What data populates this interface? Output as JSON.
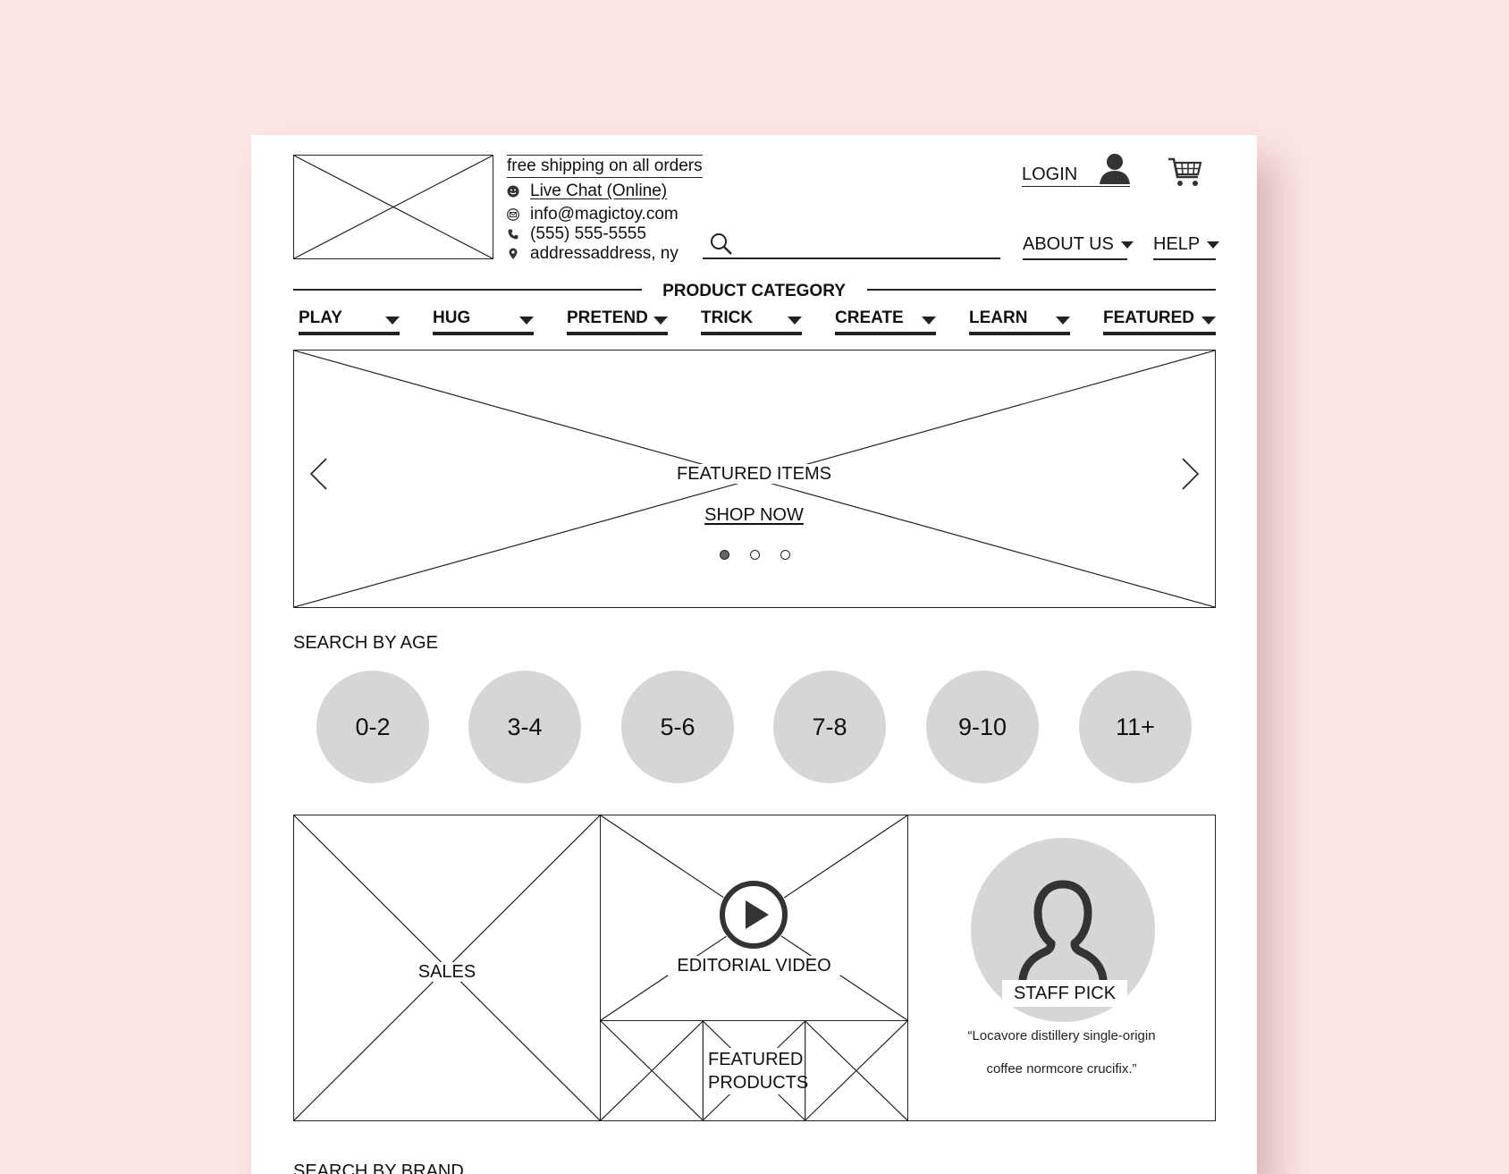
{
  "header": {
    "free_shipping": "free shipping on all orders",
    "live_chat": "Live Chat (Online)",
    "email": "info@magictoy.com",
    "phone": "(555) 555-5555",
    "address": "addressaddress, ny",
    "login": "LOGIN",
    "about_us": "ABOUT US",
    "help": "HELP"
  },
  "icons": {
    "chat": "chat-smiley-icon",
    "mail": "mail-icon",
    "phone": "phone-icon",
    "location": "location-pin-icon",
    "search": "search-icon",
    "user": "user-icon",
    "cart": "cart-icon",
    "play": "play-icon"
  },
  "categories": {
    "title": "PRODUCT CATEGORY",
    "items": [
      "PLAY",
      "HUG",
      "PRETEND",
      "TRICK",
      "CREATE",
      "LEARN",
      "FEATURED"
    ]
  },
  "hero": {
    "title": "FEATURED ITEMS",
    "cta": "SHOP NOW",
    "slides": 3,
    "active_slide": 1
  },
  "search_by_age": {
    "title": "SEARCH BY AGE",
    "ages": [
      "0-2",
      "3-4",
      "5-6",
      "7-8",
      "9-10",
      "11+"
    ]
  },
  "promo": {
    "sales": "SALES",
    "editorial_video": "EDITORIAL VIDEO",
    "featured_products_line1": "FEATURED",
    "featured_products_line2": "PRODUCTS",
    "staff_pick": "STAFF PICK",
    "quote_line1": "“Locavore distillery single-origin",
    "quote_line2": "coffee normcore crucifix.”"
  },
  "search_by_brand": {
    "title": "SEARCH BY BRAND"
  },
  "colors": {
    "background": "#fde6e6",
    "sheet": "#ffffff",
    "circle_fill": "#d6d6d6",
    "ink": "#222222"
  }
}
